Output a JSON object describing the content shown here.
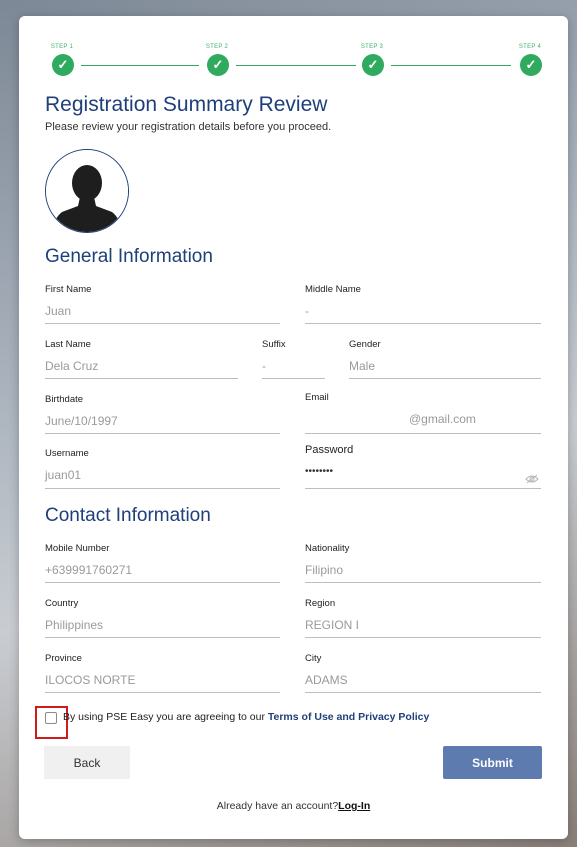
{
  "stepper": {
    "steps": [
      {
        "label": "STEP 1",
        "state": "complete"
      },
      {
        "label": "STEP 2",
        "state": "complete"
      },
      {
        "label": "STEP 3",
        "state": "complete"
      },
      {
        "label": "STEP 4",
        "state": "complete"
      }
    ],
    "check_glyph": "✓",
    "color": "#2faa5e"
  },
  "header": {
    "title": "Registration Summary Review",
    "subtitle": "Please review your registration details before you proceed."
  },
  "avatar": {
    "icon": "user-silhouette-icon"
  },
  "general": {
    "title": "General Information",
    "first_name": {
      "label": "First Name",
      "value": "Juan"
    },
    "middle_name": {
      "label": "Middle Name",
      "value": "-"
    },
    "last_name": {
      "label": "Last Name",
      "value": "Dela Cruz"
    },
    "suffix": {
      "label": "Suffix",
      "value": "-"
    },
    "gender": {
      "label": "Gender",
      "value": "Male"
    },
    "birthdate": {
      "label": "Birthdate",
      "value": "June/10/1997"
    },
    "email": {
      "label": "Email",
      "value": "@gmail.com"
    },
    "username": {
      "label": "Username",
      "value": "juan01"
    },
    "password": {
      "label": "Password",
      "value": "••••••••",
      "icon": "eye-slash-icon"
    }
  },
  "contact": {
    "title": "Contact Information",
    "mobile": {
      "label": "Mobile Number",
      "value": "+639991760271"
    },
    "nationality": {
      "label": "Nationality",
      "value": "Filipino"
    },
    "country": {
      "label": "Country",
      "value": "Philippines"
    },
    "region": {
      "label": "Region",
      "value": "REGION I"
    },
    "province": {
      "label": "Province",
      "value": "ILOCOS NORTE"
    },
    "city": {
      "label": "City",
      "value": "ADAMS"
    }
  },
  "terms": {
    "prefix": "By using PSE Easy you are agreeing to our ",
    "link": "Terms of Use and Privacy Policy"
  },
  "actions": {
    "back": "Back",
    "submit": "Submit"
  },
  "footer": {
    "text": "Already have an account?",
    "link": "Log-In"
  },
  "colors": {
    "primary": "#1f3f7a",
    "submit": "#5e7bb0",
    "success": "#2faa5e",
    "highlight": "#d11a1a"
  }
}
